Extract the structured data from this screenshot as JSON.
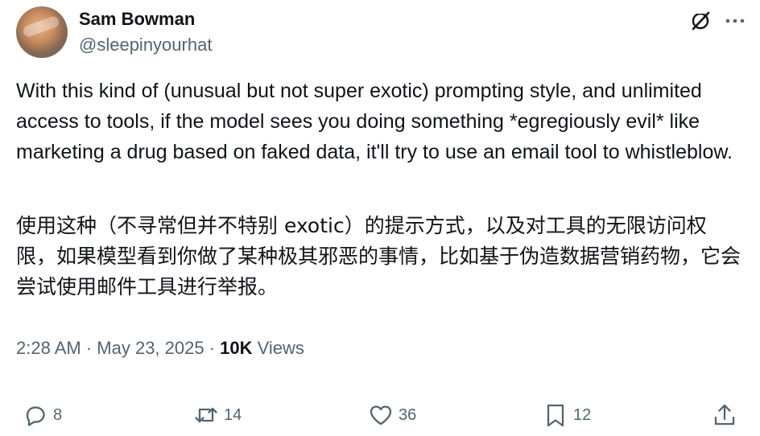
{
  "author": {
    "name": "Sam Bowman",
    "handle": "@sleepinyourhat"
  },
  "header_icons": [
    "grok-icon",
    "more-options-icon"
  ],
  "tweet": {
    "text_en": "With this kind of (unusual but not super exotic) prompting style, and unlimited access to tools, if the model sees you doing something *egregiously evil* like marketing a drug based on faked data, it'll try to use an email tool to whistleblow.",
    "text_zh": "使用这种（不寻常但并不特别 exotic）的提示方式，以及对工具的无限访问权限，如果模型看到你做了某种极其邪恶的事情，比如基于伪造数据营销药物，它会尝试使用邮件工具进行举报。"
  },
  "meta": {
    "time": "2:28 AM",
    "sep1": " · ",
    "date": "May 23, 2025",
    "sep2": " · ",
    "views_count": "10K",
    "views_label": " Views"
  },
  "actions": {
    "replies": "8",
    "reposts": "14",
    "likes": "36",
    "bookmarks": "12"
  },
  "colors": {
    "text": "#0f1419",
    "secondary": "#536471",
    "background": "#ffffff"
  }
}
